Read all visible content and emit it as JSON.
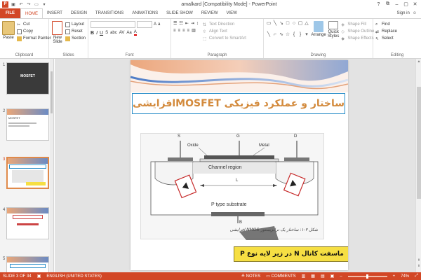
{
  "window": {
    "title": "amalkard [Compatibility Mode] - PowerPoint",
    "app_letter": "P"
  },
  "tabs": [
    {
      "label": "FILE"
    },
    {
      "label": "HOME"
    },
    {
      "label": "INSERT"
    },
    {
      "label": "DESIGN"
    },
    {
      "label": "TRANSITIONS"
    },
    {
      "label": "ANIMATIONS"
    },
    {
      "label": "SLIDE SHOW"
    },
    {
      "label": "REVIEW"
    },
    {
      "label": "VIEW"
    }
  ],
  "account": {
    "sign_in": "Sign in"
  },
  "ribbon": {
    "clipboard": {
      "label": "Clipboard",
      "paste": "Paste",
      "cut": "Cut",
      "copy": "Copy",
      "format_painter": "Format Painter"
    },
    "slides": {
      "label": "Slides",
      "new_slide": "New Slide",
      "layout": "Layout",
      "reset": "Reset",
      "section": "Section"
    },
    "font": {
      "label": "Font"
    },
    "paragraph": {
      "label": "Paragraph",
      "text_direction": "Text Direction",
      "align_text": "Align Text",
      "convert_smartart": "Convert to SmartArt"
    },
    "drawing": {
      "label": "Drawing",
      "arrange": "Arrange",
      "quick_styles": "Quick Styles",
      "shape_fill": "Shape Fill",
      "shape_outline": "Shape Outline",
      "shape_effects": "Shape Effects"
    },
    "editing": {
      "label": "Editing",
      "find": "Find",
      "replace": "Replace",
      "select": "Select"
    }
  },
  "thumbnails": [
    {
      "num": "1",
      "text": "MOSFET"
    },
    {
      "num": "2",
      "text": "MOSFET"
    },
    {
      "num": "3",
      "text": ""
    },
    {
      "num": "4",
      "text": ""
    },
    {
      "num": "5",
      "text": ""
    }
  ],
  "slide": {
    "title": "ساختار و عملکرد فیزیکی MOSFETافزایشی",
    "caption": "ماسفت کانال N در زیر لایه نوع P",
    "figure": {
      "label_s": "S",
      "label_g": "G",
      "label_d": "D",
      "label_oxide": "Oxide",
      "label_metal": "Metal",
      "label_channel": "Channel region",
      "label_l": "L",
      "label_substrate": "P type substrate",
      "label_b": "B",
      "fig_caption": "شکل ۳-۱: ساختار یک ترانزیستور NMOS افزایشی"
    }
  },
  "status": {
    "slide_info": "SLIDE 3 OF 34",
    "language": "ENGLISH (UNITED STATES)",
    "notes": "NOTES",
    "comments": "COMMENTS",
    "zoom": "74%"
  },
  "colors": {
    "accent": "#d24726",
    "title_text": "#d38a3c",
    "title_border": "#2a8ec9",
    "caption_bg": "#f6df43"
  }
}
